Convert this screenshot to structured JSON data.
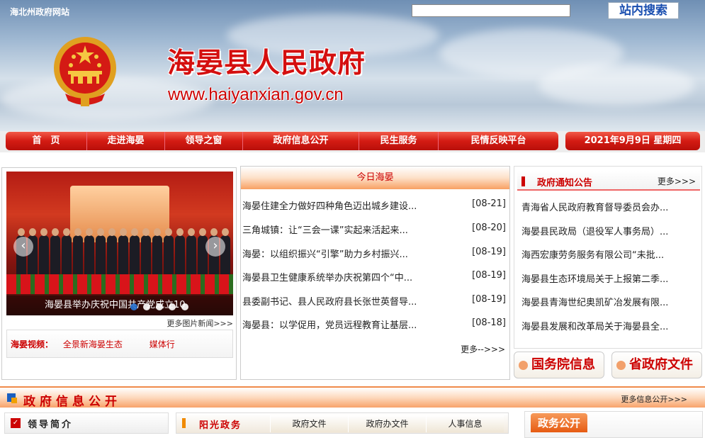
{
  "header": {
    "site_link": "海北州政府网站",
    "search_placeholder": "",
    "search_button": "站内搜索",
    "title": "海晏县人民政府",
    "url": "www.haiyanxian.gov.cn"
  },
  "nav": {
    "items": [
      "首　页",
      "走进海晏",
      "领导之窗",
      "政府信息公开",
      "民生服务",
      "民情反映平台"
    ],
    "date": "2021年9月9日 星期四"
  },
  "slider": {
    "caption": "海晏县举办庆祝中国共产党成立10",
    "more": "更多图片新闻>>>",
    "prev": "‹",
    "next": "›"
  },
  "video": {
    "label": "海晏视频：",
    "links": [
      "全景新海晏生态",
      "媒体行"
    ]
  },
  "today": {
    "title": "今日海晏",
    "items": [
      {
        "title": "海晏住建全力做好四种角色迈出城乡建设...",
        "date": "[08-21]"
      },
      {
        "title": "三角城镇：让“三会一课”实起来活起来...",
        "date": "[08-20]"
      },
      {
        "title": "海晏：以组织振兴“引擎”助力乡村振兴...",
        "date": "[08-19]"
      },
      {
        "title": "海晏县卫生健康系统举办庆祝第四个“中...",
        "date": "[08-19]"
      },
      {
        "title": "县委副书记、县人民政府县长张世英督导...",
        "date": "[08-19]"
      },
      {
        "title": "海晏县：以学促用，党员远程教育让基层...",
        "date": "[08-18]"
      }
    ],
    "more": "更多-->>>"
  },
  "notice": {
    "title": "政府通知公告",
    "more": "更多>>>",
    "items": [
      "青海省人民政府教育督导委员会办...",
      "海晏县民政局（退役军人事务局）...",
      "海西宏康劳务服务有限公司“未批...",
      "海晏县生态环境局关于上报第二季...",
      "海晏县青海世纪奥凯矿冶发展有限...",
      "海晏县发展和改革局关于海晏县全..."
    ]
  },
  "pills": [
    "国务院信息",
    "省政府文件"
  ],
  "section": {
    "title": "政府信息公开",
    "more": "更多信息公开>>>"
  },
  "leader": {
    "title": "领导简介"
  },
  "sunshine": {
    "title": "阳光政务",
    "tabs": [
      "政府文件",
      "政府办文件",
      "人事信息"
    ]
  },
  "gov_open": {
    "title": "政务公开"
  },
  "colors": {
    "accent_red": "#d31b13",
    "orange": "#f08a4a"
  }
}
